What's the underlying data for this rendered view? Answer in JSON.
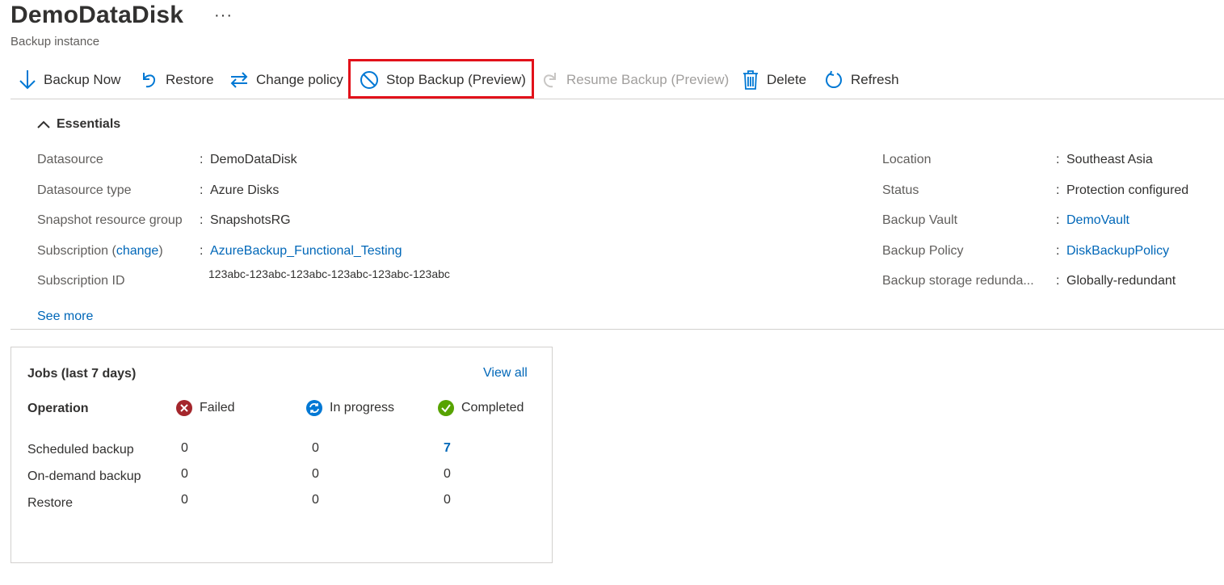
{
  "header": {
    "title": "DemoDataDisk",
    "more": "···",
    "subtitle": "Backup instance"
  },
  "toolbar": {
    "backup_now": "Backup Now",
    "restore": "Restore",
    "change_policy": "Change policy",
    "stop_backup": "Stop Backup (Preview)",
    "resume_backup": "Resume Backup (Preview)",
    "delete": "Delete",
    "refresh": "Refresh"
  },
  "essentials": {
    "toggle_label": "Essentials",
    "left": {
      "datasource_label": "Datasource",
      "datasource_value": "DemoDataDisk",
      "datasource_type_label": "Datasource type",
      "datasource_type_value": "Azure Disks",
      "snapshot_rg_label": "Snapshot resource group",
      "snapshot_rg_value": "SnapshotsRG",
      "subscription_label": "Subscription (",
      "subscription_change": "change",
      "subscription_label_end": ")",
      "subscription_value": "AzureBackup_Functional_Testing",
      "subscription_id_label": "Subscription ID",
      "subscription_id_value": "123abc-123abc-123abc-123abc-123abc-123abc"
    },
    "right": {
      "location_label": "Location",
      "location_value": "Southeast Asia",
      "status_label": "Status",
      "status_value": "Protection configured",
      "vault_label": "Backup Vault",
      "vault_value": "DemoVault",
      "policy_label": "Backup Policy",
      "policy_value": "DiskBackupPolicy",
      "redundancy_label": "Backup storage redunda...",
      "redundancy_value": "Globally-redundant"
    },
    "colon": ":",
    "see_more": "See more"
  },
  "jobs": {
    "title": "Jobs (last 7 days)",
    "view_all": "View all",
    "col_operation": "Operation",
    "col_failed": "Failed",
    "col_in_progress": "In progress",
    "col_completed": "Completed",
    "rows": [
      {
        "label": "Scheduled backup",
        "failed": "0",
        "in_progress": "0",
        "completed": "7"
      },
      {
        "label": "On-demand backup",
        "failed": "0",
        "in_progress": "0",
        "completed": "0"
      },
      {
        "label": "Restore",
        "failed": "0",
        "in_progress": "0",
        "completed": "0"
      }
    ]
  },
  "colors": {
    "accent": "#0067b8",
    "highlight": "#e2111a",
    "failed": "#a4262c",
    "in_progress": "#0078d4",
    "completed": "#57a300",
    "disabled": "#a19f9d"
  }
}
